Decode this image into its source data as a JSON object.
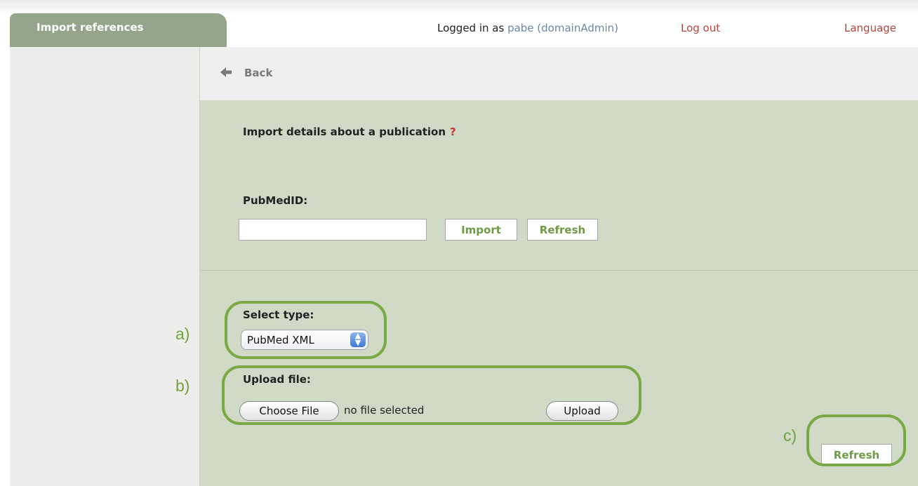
{
  "window": {
    "tab_title": "Import references"
  },
  "topbar": {
    "logged_in_as": "Logged in as",
    "user": "pabe (domainAdmin)",
    "logout": "Log out",
    "language": "Language"
  },
  "nav": {
    "back": "Back"
  },
  "pubmed_section": {
    "heading": "Import details about a publication",
    "help": "?",
    "id_label": "PubMedID:",
    "id_value": "",
    "import_button": "Import",
    "refresh_button": "Refresh"
  },
  "upload_section": {
    "type_label": "Select type:",
    "type_selected": "PubMed XML",
    "file_label": "Upload file:",
    "choose_file_button": "Choose File",
    "file_status": "no file selected",
    "upload_button": "Upload",
    "refresh_button": "Refresh"
  },
  "annotations": {
    "a": "a)",
    "b": "b)",
    "c": "c)"
  },
  "colors": {
    "panel_bg": "#d0dac6",
    "title_tab": "#95a58b",
    "accent_green": "#6f9a47",
    "link_red": "#b5433d",
    "annotation_green": "#7aaa45"
  }
}
